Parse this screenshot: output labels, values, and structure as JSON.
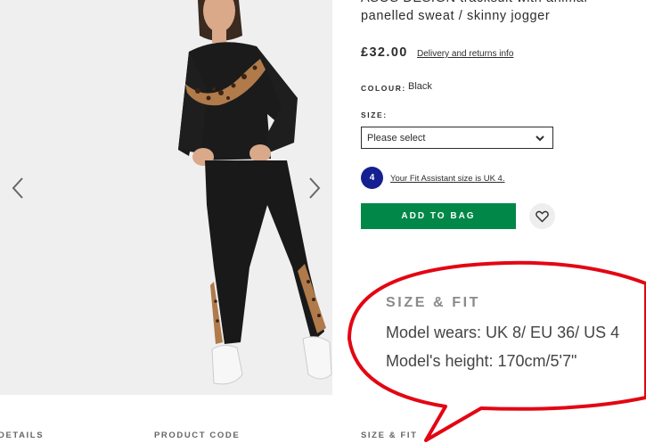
{
  "product": {
    "title": "ASOS DESIGN tracksuit with animal panelled sweat / skinny jogger",
    "price": "£32.00",
    "delivery_link": "Delivery and returns info",
    "colour_label": "COLOUR:",
    "colour_value": "Black",
    "size_label": "SIZE:",
    "size_select_value": "Please select",
    "fit_assistant_size": "4",
    "fit_assistant_text": "Your Fit Assistant size is UK 4.",
    "add_to_bag": "ADD TO BAG"
  },
  "gallery": {
    "prev_icon": "chevron-left-icon",
    "next_icon": "chevron-right-icon"
  },
  "bottom_tabs": [
    "DETAILS",
    "PRODUCT CODE",
    "SIZE & FIT"
  ],
  "callout": {
    "heading": "SIZE & FIT",
    "model_wears": "Model wears: UK 8/ EU 36/ US 4",
    "model_height": "Model's height: 170cm/5'7\""
  },
  "colors": {
    "add_to_bag": "#018849",
    "fit_badge": "#14208f",
    "annotation": "#e30613",
    "photo_bg": "#efeff0"
  }
}
